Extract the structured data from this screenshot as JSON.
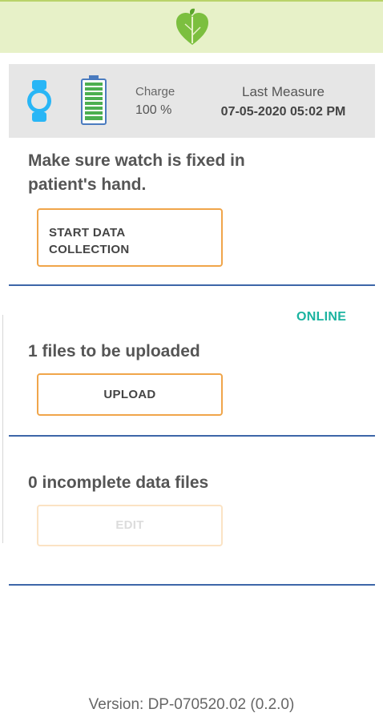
{
  "header": {
    "logo_icon": "leaf-heart-logo"
  },
  "status": {
    "watch_icon": "watch-icon",
    "battery_icon": "battery-full-icon",
    "charge_label": "Charge",
    "charge_value": "100 %",
    "last_measure_label": "Last Measure",
    "last_measure_value": "07-05-2020 05:02 PM"
  },
  "collection": {
    "instruction": "Make sure watch is fixed in patient's hand.",
    "button_line1": "START DATA",
    "button_line2": "COLLECTION"
  },
  "upload": {
    "connection_status": "ONLINE",
    "files_text": "1 files to be uploaded",
    "button_label": "UPLOAD"
  },
  "incomplete": {
    "files_text": "0 incomplete data files",
    "button_label": "EDIT"
  },
  "footer": {
    "version": "Version: DP-070520.02 (0.2.0)"
  },
  "colors": {
    "header_bg": "#e7f1c8",
    "accent_orange": "#f0a54a",
    "divider_blue": "#3d66a8",
    "online_teal": "#1bb3a0"
  }
}
